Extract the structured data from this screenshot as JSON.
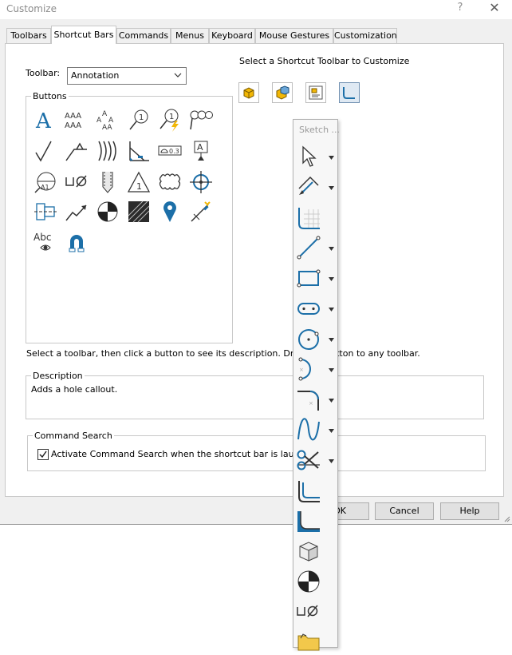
{
  "window": {
    "title": "Customize",
    "help": "?",
    "close": "✕"
  },
  "tabs": [
    {
      "label": "Toolbars"
    },
    {
      "label": "Shortcut Bars",
      "active": true
    },
    {
      "label": "Commands"
    },
    {
      "label": "Menus"
    },
    {
      "label": "Keyboard"
    },
    {
      "label": "Mouse Gestures"
    },
    {
      "label": "Customization"
    }
  ],
  "toolbar": {
    "label": "Toolbar:",
    "selected": "Annotation"
  },
  "shortcut_select": {
    "label": "Select a Shortcut Toolbar to Customize",
    "icons": [
      "part-icon",
      "assembly-icon",
      "drawing-icon",
      "sketch-icon"
    ]
  },
  "buttons_group": {
    "title": "Buttons",
    "icons": [
      "note-icon",
      "linear-note-pattern-icon",
      "circular-note-pattern-icon",
      "balloon-icon",
      "auto-balloon-icon",
      "stacked-balloon-icon",
      "surface-finish-icon",
      "weld-symbol-icon",
      "hatch-lines-icon",
      "datum-target-icon",
      "geometric-tolerance-icon",
      "datum-feature-icon",
      "datum-target-balloon-icon",
      "hole-callout-icon",
      "cosmetic-thread-icon",
      "revision-symbol-icon",
      "revision-cloud-icon",
      "center-mark-icon",
      "center-line-icon",
      "multi-jog-leader-icon",
      "area-hatch-icon",
      "block-hatch-icon",
      "location-pin-icon",
      "magnetic-line-icon",
      "hide-show-annotations-icon",
      "magnet-icon"
    ]
  },
  "instructions": "Select a toolbar, then click a button to see its description. Drag the button to any toolbar.",
  "description": {
    "title": "Description",
    "text": "Adds a hole callout."
  },
  "command_search": {
    "title": "Command Search",
    "checkbox_label": "Activate Command Search when the shortcut bar is launched",
    "checked": true
  },
  "buttons": {
    "ok": "OK",
    "cancel": "Cancel",
    "help": "Help"
  },
  "flyout": {
    "search_placeholder": "Sketch ...",
    "items": [
      {
        "icon": "select-icon",
        "dropdown": true
      },
      {
        "icon": "smart-dimension-icon",
        "dropdown": true
      },
      {
        "icon": "sketch-grid-icon",
        "dropdown": false
      },
      {
        "icon": "line-icon",
        "dropdown": true
      },
      {
        "icon": "rectangle-icon",
        "dropdown": true
      },
      {
        "icon": "slot-icon",
        "dropdown": true
      },
      {
        "icon": "circle-icon",
        "dropdown": true
      },
      {
        "icon": "arc-icon",
        "dropdown": true
      },
      {
        "icon": "fillet-icon",
        "dropdown": true
      },
      {
        "icon": "spline-icon",
        "dropdown": true
      },
      {
        "icon": "trim-icon",
        "dropdown": true
      },
      {
        "icon": "offset-entities-icon",
        "dropdown": false
      },
      {
        "icon": "convert-entities-icon",
        "dropdown": false
      },
      {
        "icon": "cube-icon",
        "dropdown": false
      },
      {
        "icon": "section-view-icon",
        "dropdown": false
      },
      {
        "icon": "hole-callout-icon",
        "dropdown": false
      },
      {
        "icon": "folder-icon",
        "dropdown": false
      }
    ]
  },
  "colors": {
    "accent": "#1c6fa8",
    "icon_dark": "#333333",
    "dialog_bg": "#f0f0f0"
  }
}
